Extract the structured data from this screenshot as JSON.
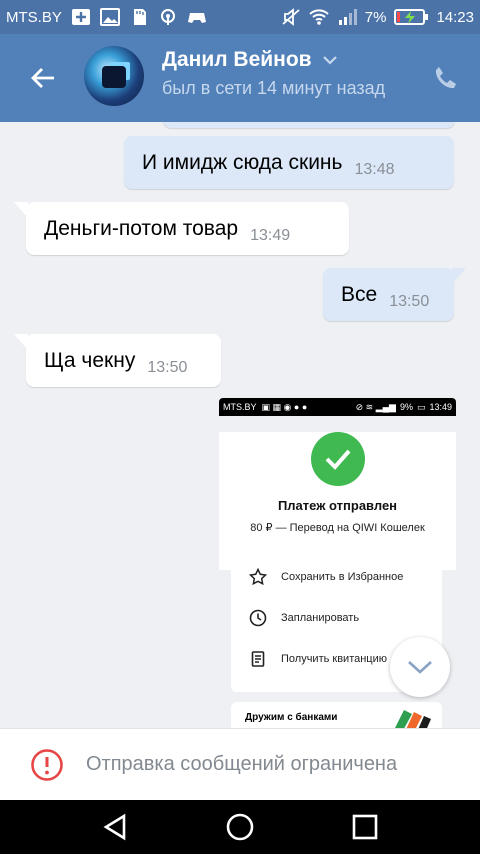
{
  "status_bar": {
    "carrier": "MTS.BY",
    "battery": "7%",
    "time": "14:23"
  },
  "header": {
    "name": "Данил Вейнов",
    "last_seen": "был в сети 14 минут назад",
    "icons": [
      "back-arrow-icon",
      "chevron-down-icon",
      "phone-icon"
    ]
  },
  "messages": [
    {
      "direction": "out",
      "text": "И имидж сюда скинь",
      "time": "13:48"
    },
    {
      "direction": "in",
      "text": "Деньги-потом товар",
      "time": "13:49"
    },
    {
      "direction": "out",
      "text": "Все",
      "time": "13:50"
    },
    {
      "direction": "in",
      "text": "Ща чекну",
      "time": "13:50"
    }
  ],
  "attachment": {
    "status_carrier": "MTS.BY",
    "status_battery": "9%",
    "status_time": "13:49",
    "title": "Платеж отправлен",
    "subtitle": "80 ₽ — Перевод на QIWI Кошелек",
    "actions": [
      {
        "label": "Сохранить в Избранное",
        "icon": "star-icon"
      },
      {
        "label": "Запланировать",
        "icon": "clock-icon"
      },
      {
        "label": "Получить квитанцию",
        "icon": "receipt-icon"
      }
    ],
    "banner": "Дружим с банками"
  },
  "restriction": {
    "text": "Отправка сообщений ограничена",
    "icon": "alert-circle-icon"
  },
  "colors": {
    "header": "#5181b8",
    "status_bar": "#4b73a8",
    "outgoing_bubble": "#dce8f8",
    "incoming_bubble": "#ffffff",
    "background": "#eef0f3",
    "alert_red": "#e64646",
    "check_green": "#3fb950"
  }
}
